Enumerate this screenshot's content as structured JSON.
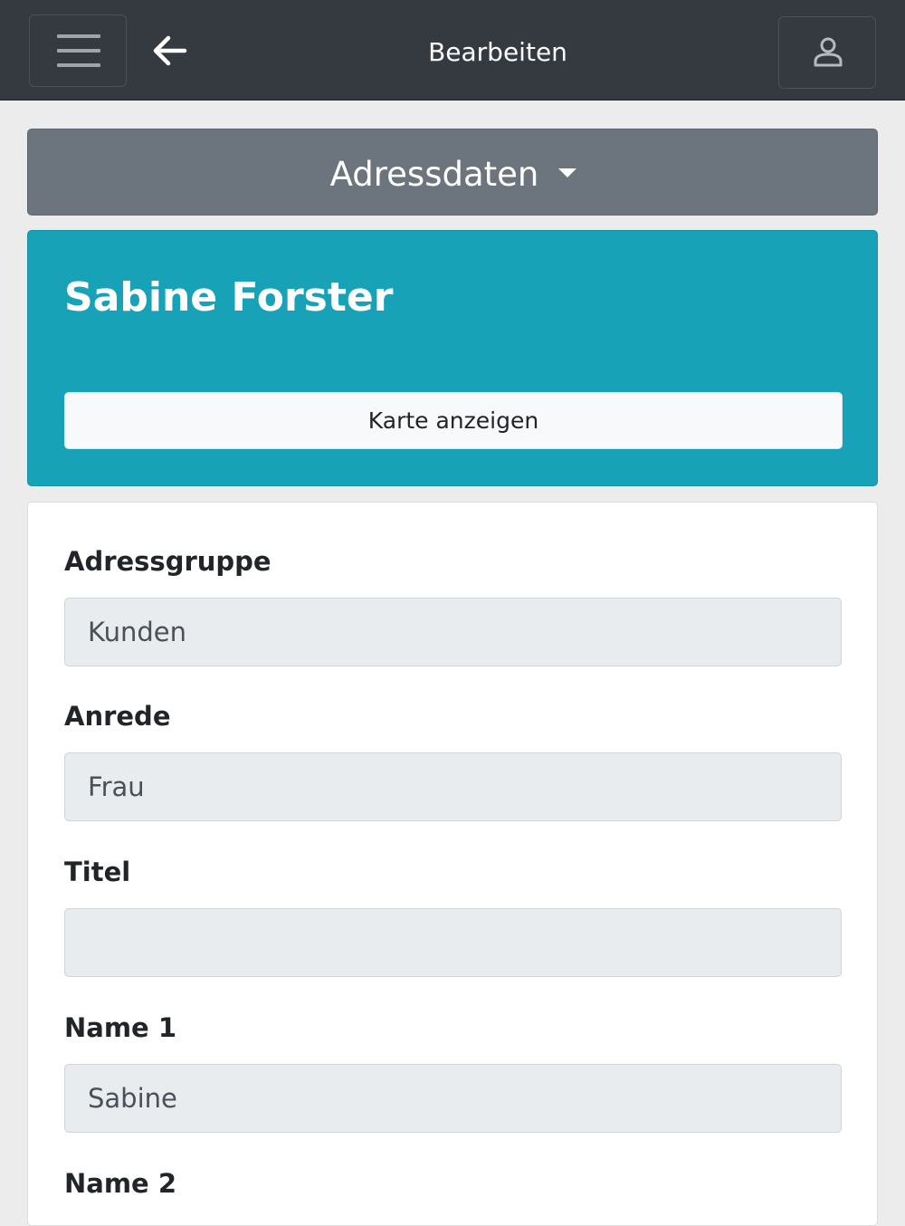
{
  "header": {
    "title": "Bearbeiten",
    "menu_icon": "hamburger-menu-icon",
    "back_icon": "arrow-left-icon",
    "user_icon": "user-icon"
  },
  "section": {
    "label": "Adressdaten",
    "icon": "caret-down-icon"
  },
  "contact": {
    "name": "Sabine Forster",
    "map_button": "Karte anzeigen"
  },
  "form": {
    "fields": [
      {
        "label": "Adressgruppe",
        "value": "Kunden"
      },
      {
        "label": "Anrede",
        "value": "Frau"
      },
      {
        "label": "Titel",
        "value": ""
      },
      {
        "label": "Name 1",
        "value": "Sabine"
      },
      {
        "label": "Name 2",
        "value": ""
      }
    ]
  },
  "colors": {
    "topbar": "#343a40",
    "dropdown": "#6c757d",
    "hero": "#17a2b8",
    "input_bg": "#e9ecef",
    "page_bg": "#ececec"
  }
}
